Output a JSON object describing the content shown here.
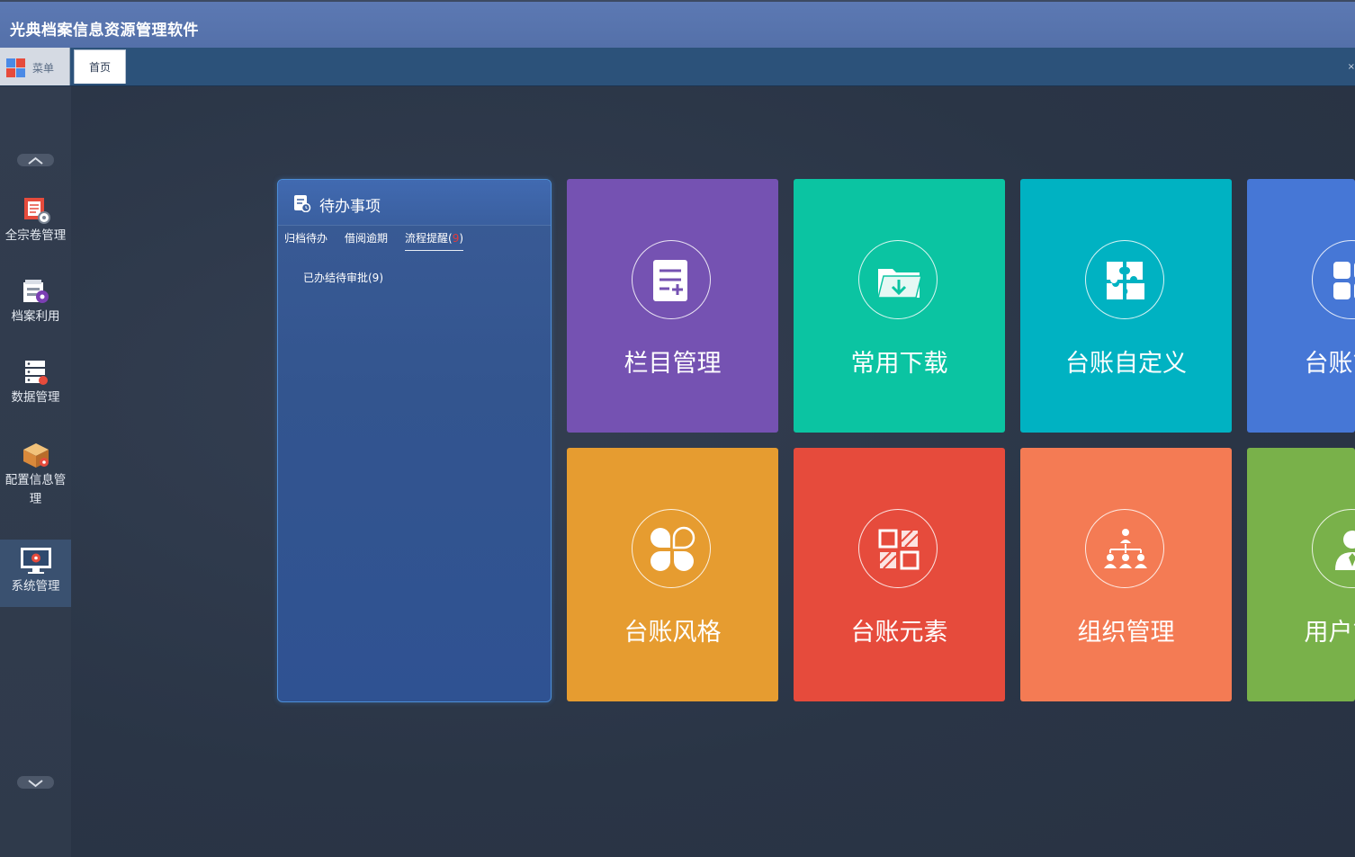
{
  "app": {
    "title": "光典档案信息资源管理软件"
  },
  "tabbar": {
    "menu_label": "菜单",
    "tabs": [
      {
        "label": "首页"
      }
    ],
    "edge_glyph": "×"
  },
  "sidebar": {
    "items": [
      {
        "label": "全宗卷管理",
        "icon": "archive-folder-gear-icon"
      },
      {
        "label": "档案利用",
        "icon": "archive-usage-icon"
      },
      {
        "label": "数据管理",
        "icon": "server-data-icon"
      },
      {
        "label": "配置信息管理",
        "icon": "package-config-icon"
      },
      {
        "label": "系统管理",
        "icon": "monitor-settings-icon",
        "active": true
      }
    ]
  },
  "todo": {
    "title": "待办事项",
    "tabs": [
      {
        "label": "归档待办"
      },
      {
        "label": "借阅逾期"
      },
      {
        "label": "流程提醒(",
        "badge": "9",
        "suffix": ")",
        "active": true
      }
    ],
    "items": [
      {
        "label": "已办结待审批(9)"
      }
    ]
  },
  "tiles": [
    {
      "label": "栏目管理",
      "color": "#7552b2",
      "icon": "column-list-icon"
    },
    {
      "label": "常用下载",
      "color": "#0bc4a2",
      "icon": "folder-download-icon"
    },
    {
      "label": "台账自定义",
      "color": "#00b2c2",
      "icon": "puzzle-icon"
    },
    {
      "label": "台账管理",
      "color": "#4677d6",
      "icon": "grid-squares-icon"
    },
    {
      "label": "台账风格",
      "color": "#e69c30",
      "icon": "clover-shapes-icon"
    },
    {
      "label": "台账元素",
      "color": "#e64b3c",
      "icon": "element-grid-icon"
    },
    {
      "label": "组织管理",
      "color": "#f47b54",
      "icon": "org-chart-icon"
    },
    {
      "label": "用户管理",
      "color": "#79b14a",
      "icon": "user-icon"
    }
  ]
}
